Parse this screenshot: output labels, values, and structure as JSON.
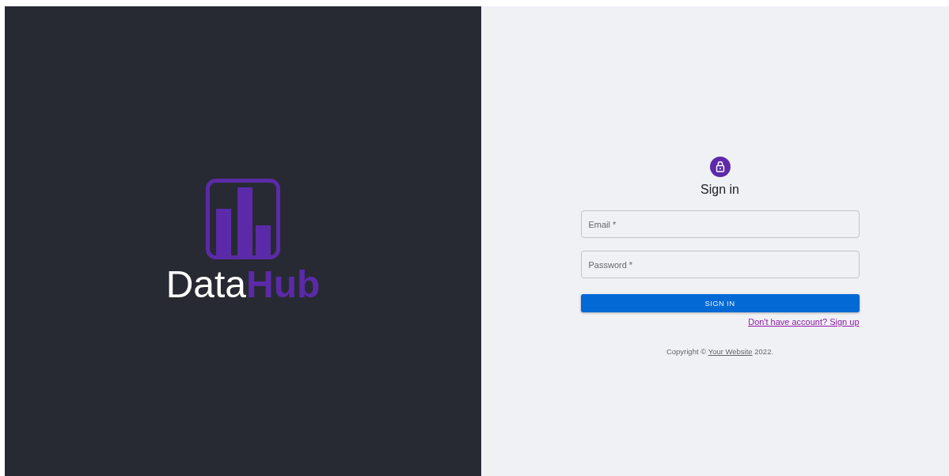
{
  "brand": {
    "logo_text": "Data**Hub**"
  },
  "form": {
    "title": "Sign in",
    "fields": [
      {
        "placeholder": "Email *"
      },
      {
        "placeholder": "Password *"
      }
    ],
    "submit": "SIGN IN",
    "signup_link": "Don't have account? Sign up"
  },
  "footer": {
    "prefix": "Copyright © ",
    "link": "Your Website",
    "suffix": " 2022."
  }
}
